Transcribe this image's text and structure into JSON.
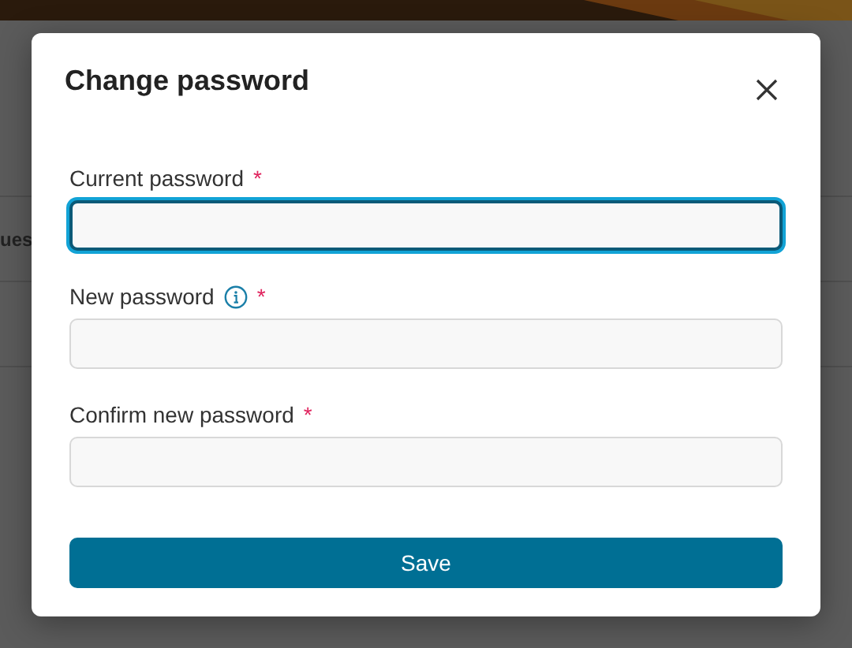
{
  "background": {
    "cut_text": "ues"
  },
  "dialog": {
    "title": "Change password",
    "fields": [
      {
        "label": "Current password",
        "required_mark": "*",
        "info": false,
        "focused": true
      },
      {
        "label": "New password",
        "required_mark": "*",
        "info": true,
        "focused": false
      },
      {
        "label": "Confirm new password",
        "required_mark": "*",
        "info": false,
        "focused": false
      }
    ],
    "submit": "Save"
  }
}
